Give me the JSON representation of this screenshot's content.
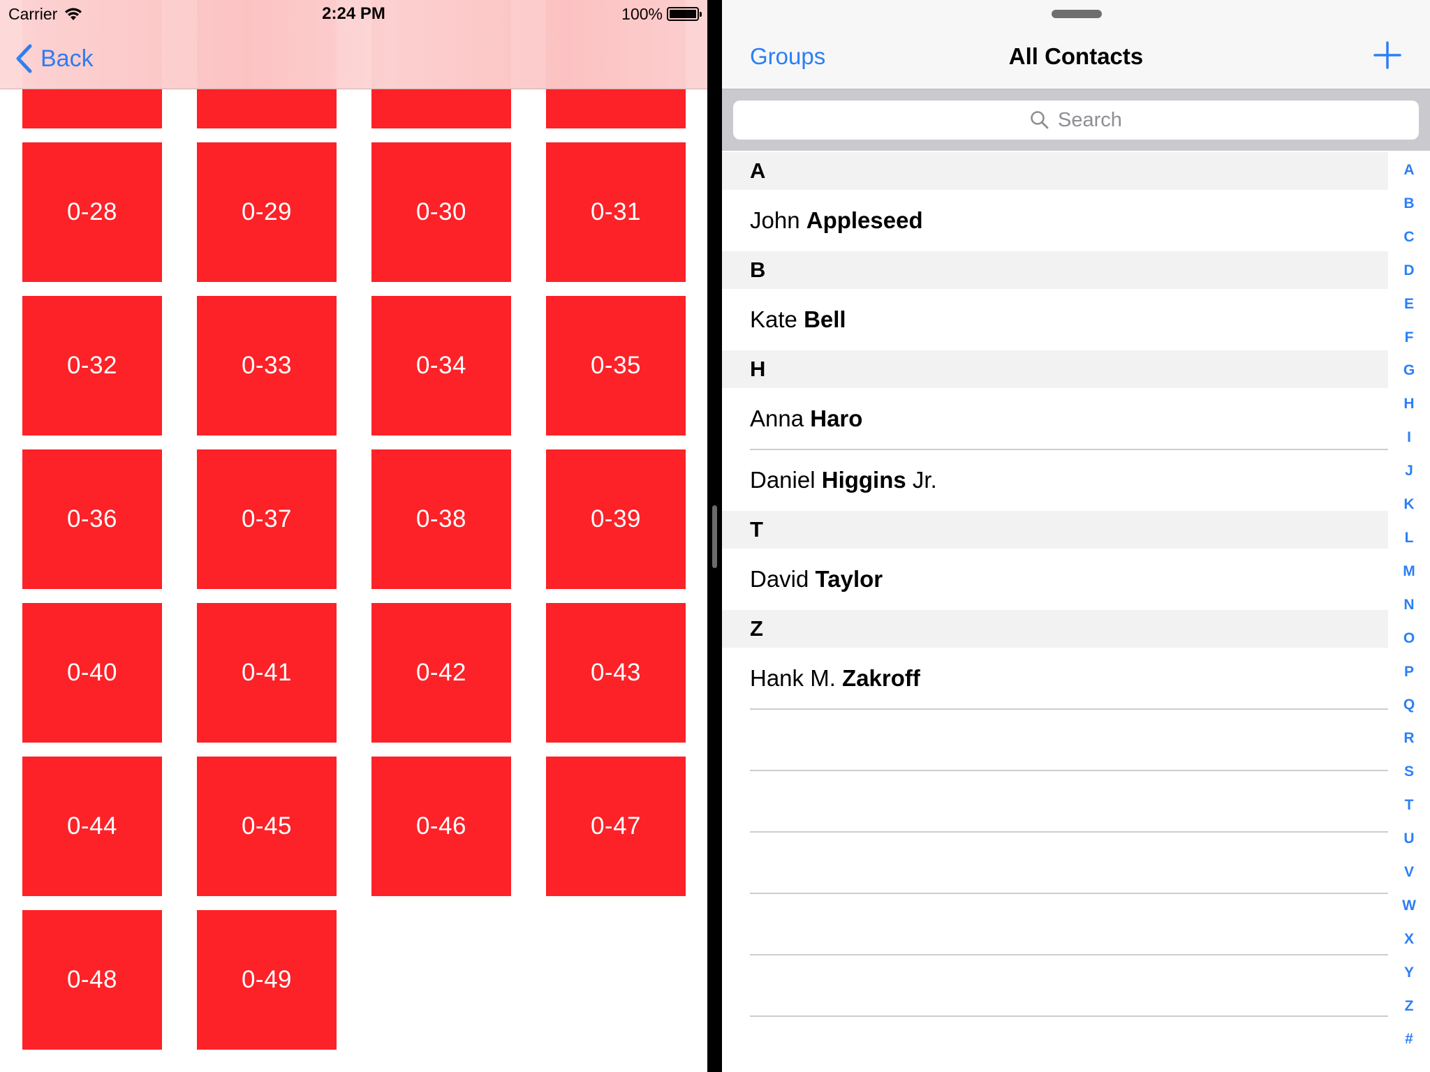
{
  "status_bar": {
    "carrier": "Carrier",
    "time": "2:24 PM",
    "battery": "100%"
  },
  "left_nav": {
    "back_label": "Back"
  },
  "grid": {
    "tile_color": "#fc2228",
    "top_partial_tiles": [
      "",
      "",
      "",
      ""
    ],
    "tiles": [
      "0-28",
      "0-29",
      "0-30",
      "0-31",
      "0-32",
      "0-33",
      "0-34",
      "0-35",
      "0-36",
      "0-37",
      "0-38",
      "0-39",
      "0-40",
      "0-41",
      "0-42",
      "0-43",
      "0-44",
      "0-45",
      "0-46",
      "0-47",
      "0-48",
      "0-49"
    ]
  },
  "contacts_nav": {
    "groups_label": "Groups",
    "title": "All Contacts",
    "add_icon": "plus-icon"
  },
  "search": {
    "placeholder": "Search"
  },
  "sections": [
    {
      "letter": "A",
      "contacts": [
        {
          "first": "John ",
          "last": "Appleseed",
          "suffix": ""
        }
      ]
    },
    {
      "letter": "B",
      "contacts": [
        {
          "first": "Kate ",
          "last": "Bell",
          "suffix": ""
        }
      ]
    },
    {
      "letter": "H",
      "contacts": [
        {
          "first": "Anna ",
          "last": "Haro",
          "suffix": ""
        },
        {
          "first": "Daniel ",
          "last": "Higgins",
          "suffix": " Jr."
        }
      ]
    },
    {
      "letter": "T",
      "contacts": [
        {
          "first": "David ",
          "last": "Taylor",
          "suffix": ""
        }
      ]
    },
    {
      "letter": "Z",
      "contacts": [
        {
          "first": "Hank M. ",
          "last": "Zakroff",
          "suffix": ""
        }
      ]
    }
  ],
  "index": [
    "A",
    "B",
    "C",
    "D",
    "E",
    "F",
    "G",
    "H",
    "I",
    "J",
    "K",
    "L",
    "M",
    "N",
    "O",
    "P",
    "Q",
    "R",
    "S",
    "T",
    "U",
    "V",
    "W",
    "X",
    "Y",
    "Z",
    "#"
  ],
  "colors": {
    "accent": "#2b7ff6",
    "tile": "#fc2228"
  }
}
